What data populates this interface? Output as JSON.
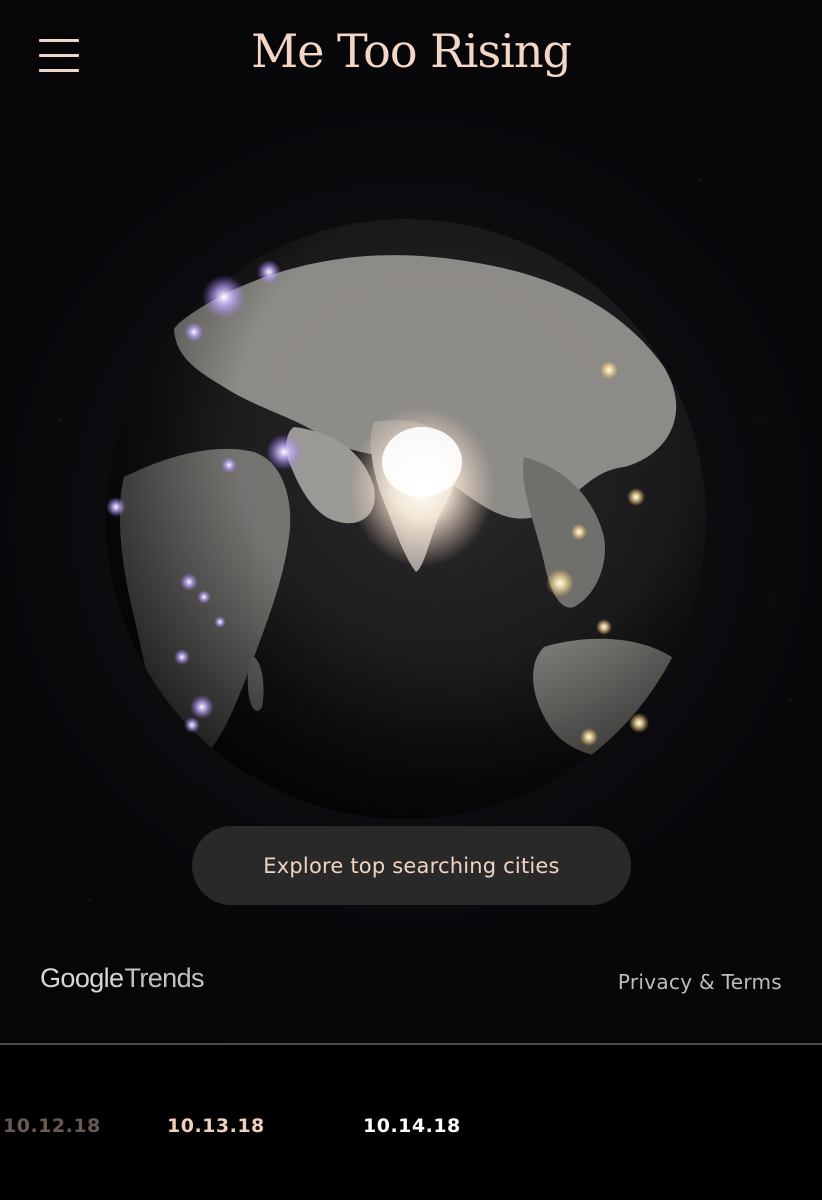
{
  "header": {
    "title": "Me Too Rising",
    "menu_icon": "hamburger-menu-icon"
  },
  "main": {
    "explore_label": "Explore top searching cities"
  },
  "footer": {
    "logo_google": "Google",
    "logo_trends": "Trends",
    "privacy_label": "Privacy & Terms"
  },
  "timeline": {
    "dates": [
      "10.12.18",
      "10.13.18",
      "10.14.18"
    ]
  },
  "colors": {
    "accent": "#f4d6c6",
    "background": "#050507",
    "button_bg": "#2a2929",
    "hotspot_europe_africa": "#b8a2ff",
    "hotspot_asia": "#ffe6a8",
    "hotspot_india": "#fff8ea"
  }
}
